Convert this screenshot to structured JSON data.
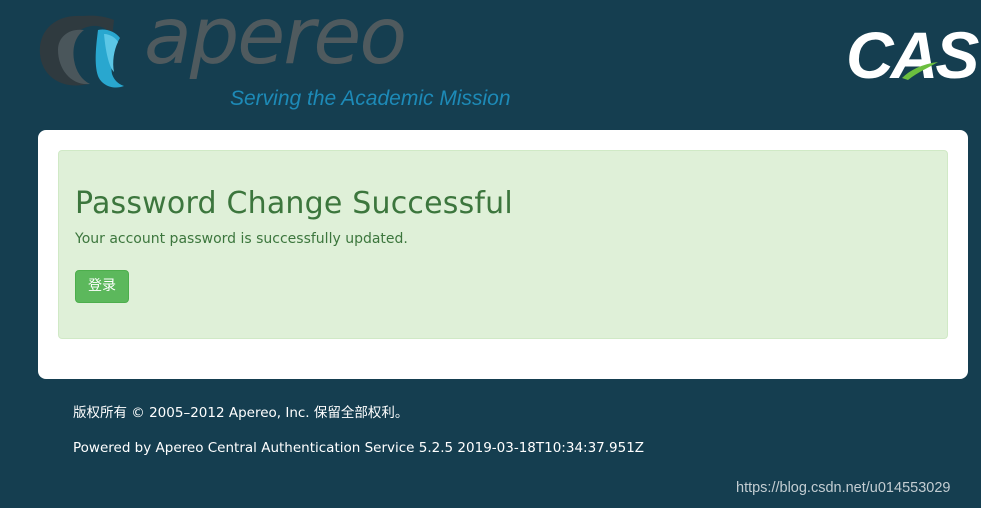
{
  "header": {
    "logo_word": "apereo",
    "logo_tagline": "Serving the Academic Mission",
    "cas_logo_text": "CAS"
  },
  "alert": {
    "title": "Password Change Successful",
    "message": "Your account password is successfully updated.",
    "login_button_label": "登录"
  },
  "footer": {
    "copyright": "版权所有 © 2005–2012 Apereo, Inc. 保留全部权利。",
    "powered_by": "Powered by Apereo Central Authentication Service 5.2.5 2019-03-18T10:34:37.951Z"
  },
  "watermark": "https://blog.csdn.net/u014553029",
  "colors": {
    "page_background": "#153e50",
    "alert_background": "#dff0d8",
    "alert_text": "#3c763d",
    "button_background": "#5cb85c",
    "tagline_blue": "#1d8ab7"
  },
  "icons": {
    "apereo_mark": "apereo-logo-mark",
    "cas_swoosh": "cas-swoosh-icon"
  }
}
